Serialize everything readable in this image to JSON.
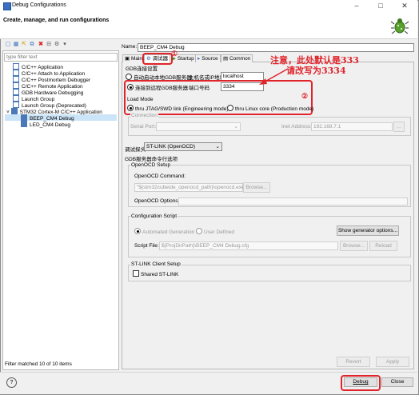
{
  "window": {
    "title": "Debug Configurations",
    "header": "Create, manage, and run configurations"
  },
  "left": {
    "filter_placeholder": "type filter text",
    "tree": [
      {
        "label": "C/C++ Application",
        "indent": 1
      },
      {
        "label": "C/C++ Attach to Application",
        "indent": 1
      },
      {
        "label": "C/C++ Postmortem Debugger",
        "indent": 1
      },
      {
        "label": "C/C++ Remote Application",
        "indent": 1
      },
      {
        "label": "GDB Hardware Debugging",
        "indent": 1
      },
      {
        "label": "Launch Group",
        "indent": 1
      },
      {
        "label": "Launch Group (Deprecated)",
        "indent": 1
      },
      {
        "label": "STM32 Cortex-M C/C++ Application",
        "indent": 0
      },
      {
        "label": "BEEP_CM4 Debug",
        "indent": 2
      },
      {
        "label": "LED_CM4 Debug",
        "indent": 2
      }
    ],
    "status": "Filter matched 10 of 10 items"
  },
  "right": {
    "name_label": "Name:",
    "name_value": "BEEP_CM4 Debug",
    "tabs": [
      "Main",
      "调试器",
      "Startup",
      "Source",
      "Common"
    ],
    "gdb_group": "GDB连接设置",
    "local_radio": "自动启动本地GDB服务器",
    "host_label": "主机名或IP地址",
    "host_value": "localhost",
    "remote_radio": "连接到远程GDB服务器",
    "port_label": "端口号码",
    "port_value": "3334",
    "load_mode_label": "Load Mode",
    "jtag_radio": "thru JTAG/SWD link (Engineering mode)",
    "linux_radio": "thru Linux core (Production mode)",
    "connection_label": "Connection",
    "serial_port_label": "Serial Port:",
    "inet_label": "Inet Address:",
    "inet_value": "192.168.7.1",
    "probe_label": "调试探头",
    "probe_value": "ST-LINK (OpenOCD)",
    "gdb_cmd_group": "GDB服务器命令行选项",
    "openocd_setup": "OpenOCD Setup",
    "openocd_cmd_label": "OpenOCD Command:",
    "openocd_cmd_value": "\"${stm32cubeide_openocd_path}\\openocd.exe\"",
    "browse": "Browse...",
    "openocd_options_label": "OpenOCD Options :",
    "config_script_label": "Configuration Script",
    "auto_gen": "Automated Generation",
    "user_defined": "User Defined",
    "show_gen_options": "Show generator options...",
    "script_file_label": "Script File:",
    "script_file_value": "${ProjDirPath}\\BEEP_CM4 Debug.cfg",
    "reload": "Reload",
    "stlink_setup": "ST-LINK Client Setup",
    "shared_stlink": "Shared ST-LINK",
    "revert": "Revert",
    "apply": "Apply"
  },
  "annotations": {
    "note1": "注意，此处默认是333",
    "note2": "请改写为3334",
    "marker1": "①",
    "marker2": "②"
  },
  "bottom": {
    "help": "?",
    "debug": "Debug",
    "close": "Close"
  },
  "colors": {
    "annotation": "#e0242b",
    "selection": "#cce4f7",
    "accent": "#3a6fbf"
  }
}
